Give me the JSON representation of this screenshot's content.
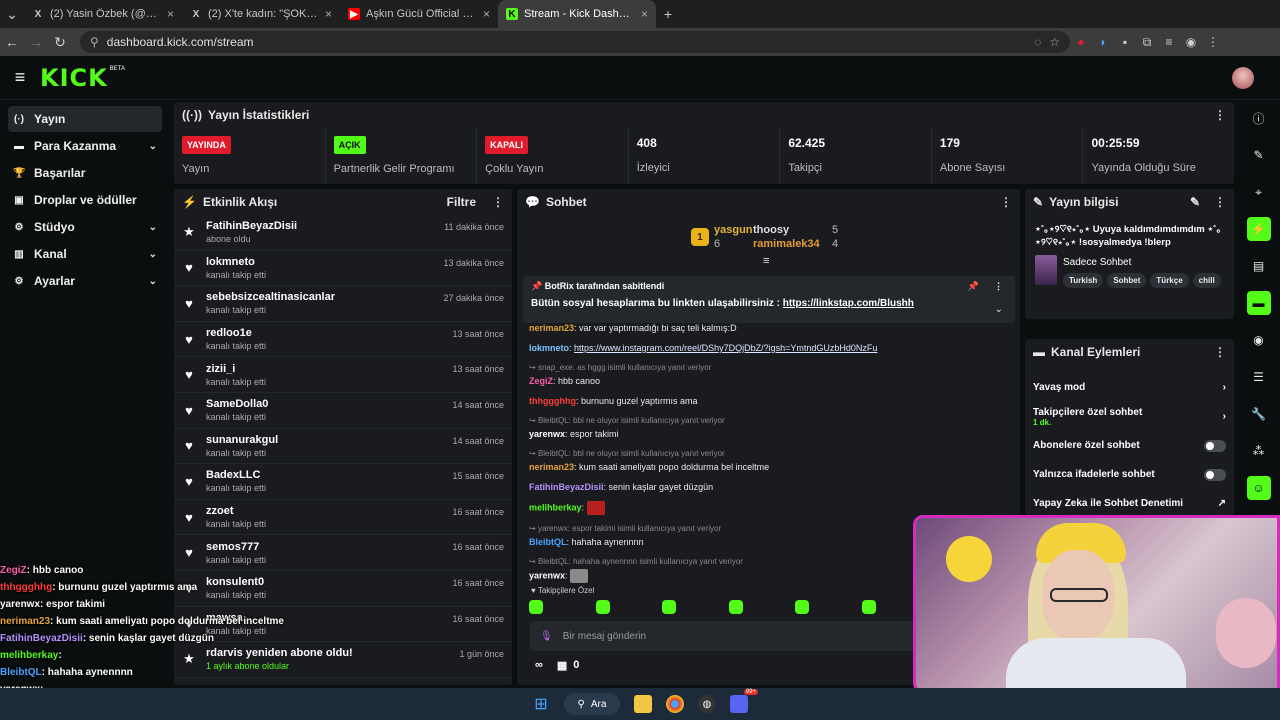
{
  "browser": {
    "tabs": [
      {
        "title": "(2) Yasin Özbek (@yasinozbek_",
        "icon": "X",
        "active": false
      },
      {
        "title": "(2) X'te kadın: \"ŞOK ŞOK ŞOK p",
        "icon": "X",
        "active": false
      },
      {
        "title": "Aşkın Gücü Official - YouTube",
        "icon": "▶",
        "active": false
      },
      {
        "title": "Stream - Kick Dashboard",
        "icon": "K",
        "active": true
      }
    ],
    "url": "dashboard.kick.com/stream"
  },
  "header": {
    "logo": "KICK",
    "beta": "BETA"
  },
  "sidebar": {
    "items": [
      {
        "label": "Yayın",
        "icon": "(·)",
        "chevron": ""
      },
      {
        "label": "Para Kazanma",
        "icon": "▬",
        "chevron": "⌄"
      },
      {
        "label": "Başarılar",
        "icon": "🏆",
        "chevron": ""
      },
      {
        "label": "Droplar ve ödüller",
        "icon": "▣",
        "chevron": ""
      },
      {
        "label": "Stüdyo",
        "icon": "⚙",
        "chevron": "⌄"
      },
      {
        "label": "Kanal",
        "icon": "▥",
        "chevron": "⌄"
      },
      {
        "label": "Ayarlar",
        "icon": "⚙",
        "chevron": "⌄"
      }
    ]
  },
  "stats": {
    "title": "Yayın İstatistikleri",
    "cards": [
      {
        "pill": "YAYINDA",
        "label": "Yayın"
      },
      {
        "pill": "AÇIK",
        "label": "Partnerlik Gelir Programı"
      },
      {
        "pill": "KAPALI",
        "label": "Çoklu Yayın"
      },
      {
        "value": "408",
        "label": "İzleyici"
      },
      {
        "value": "62.425",
        "label": "Takipçi"
      },
      {
        "value": "179",
        "label": "Abone Sayısı"
      },
      {
        "value": "00:25:59",
        "label": "Yayında Olduğu Süre"
      }
    ]
  },
  "feed": {
    "title": "Etkinlik Akışı",
    "filter": "Filtre",
    "items": [
      {
        "name": "FatihinBeyazDisii",
        "sub": "abone oldu",
        "time": "11 dakika önce",
        "icon": "★"
      },
      {
        "name": "lokmneto",
        "sub": "kanalı takip etti",
        "time": "13 dakika önce",
        "icon": "♥"
      },
      {
        "name": "sebebsizcealtinasicanlar",
        "sub": "kanalı takip etti",
        "time": "27 dakika önce",
        "icon": "♥"
      },
      {
        "name": "redloo1e",
        "sub": "kanalı takip etti",
        "time": "13 saat önce",
        "icon": "♥"
      },
      {
        "name": "zizii_i",
        "sub": "kanalı takip etti",
        "time": "13 saat önce",
        "icon": "♥"
      },
      {
        "name": "SameDolla0",
        "sub": "kanalı takip etti",
        "time": "14 saat önce",
        "icon": "♥"
      },
      {
        "name": "sunanurakgul",
        "sub": "kanalı takip etti",
        "time": "14 saat önce",
        "icon": "♥"
      },
      {
        "name": "BadexLLC",
        "sub": "kanalı takip etti",
        "time": "15 saat önce",
        "icon": "♥"
      },
      {
        "name": "zzoet",
        "sub": "kanalı takip etti",
        "time": "16 saat önce",
        "icon": "♥"
      },
      {
        "name": "semos777",
        "sub": "kanalı takip etti",
        "time": "16 saat önce",
        "icon": "♥"
      },
      {
        "name": "konsulent0",
        "sub": "kanalı takip etti",
        "time": "16 saat önce",
        "icon": "♥"
      },
      {
        "name": "mawsa",
        "sub": "kanalı takip etti",
        "time": "16 saat önce",
        "icon": "♥"
      },
      {
        "name": "rdarvis yeniden abone oldu!",
        "sub": "1 aylık abone oldular",
        "time": "1 gün önce",
        "icon": "★"
      }
    ]
  },
  "chat": {
    "title": "Sohbet",
    "leaderboard": {
      "rank": "1",
      "first": {
        "name": "yasgun",
        "count": "6"
      },
      "second": {
        "name": "thoosy",
        "count": "5"
      },
      "third": {
        "name": "ramimalek34",
        "count": "4"
      }
    },
    "pinned": {
      "by": "BotRix tarafından sabitlendi",
      "text": "Bütün sosyal hesaplarıma bu linkten ulaşabilirsiniz : ",
      "link": "https://linkstap.com/Blushh"
    },
    "messages": [
      {
        "reply": "",
        "user": "neriman23",
        "color": "#e5a43b",
        "text": ": var var yaptırmadığı bi saç teli kalmış:D"
      },
      {
        "reply": "",
        "user": "lokmneto",
        "color": "#7cc4ff",
        "text": ": ",
        "link": "https://www.instagram.com/reel/DShy7DQjDbZ/?igsh=YmtndGUzbHd0NzFu"
      },
      {
        "reply": "snap_exe: as hggg isimli kullanıcıya yanıt veriyor",
        "user": "ZegiZ",
        "color": "#ff5fa8",
        "text": ": hbb canoo"
      },
      {
        "reply": "",
        "user": "thhggghhg",
        "color": "#ff3b3b",
        "text": ": burnunu guzel yaptırmıs ama"
      },
      {
        "reply": "BleibtQL: bbl ne oluyor isimli kullanıcıya yanıt veriyor",
        "user": "yarenwx",
        "color": "#ffffff",
        "text": ": espor takimi"
      },
      {
        "reply": "BleibtQL: bbl ne oluyor isimli kullanıcıya yanıt veriyor",
        "user": "neriman23",
        "color": "#e5a43b",
        "text": ": kum saati ameliyatı popo doldurma bel inceltme"
      },
      {
        "reply": "",
        "user": "FatihinBeyazDisii",
        "color": "#b693ff",
        "text": ": senin kaşlar gayet düzgün"
      },
      {
        "reply": "",
        "user": "melihberkay",
        "color": "#53fc18",
        "text": ":"
      },
      {
        "reply": "yarenwx: espor takimi isimli kullanıcıya yanıt veriyor",
        "user": "BleibtQL",
        "color": "#4aa3ff",
        "text": ": hahaha aynennnn"
      },
      {
        "reply": "BleibtQL: hahaha aynennnn isimli kullanıcıya yanıt veriyor",
        "user": "yarenwx",
        "color": "#ffffff",
        "text": ":"
      }
    ],
    "followers_only": "Takipçilere Özel",
    "placeholder": "Bir mesaj gönderin",
    "points": "0"
  },
  "stream_info": {
    "title": "Yayın bilgisi",
    "description": "⋆˚｡⋆୨♡୧⋆˚｡⋆ Uyuya kaldımdımdımdım ⋆˚｡⋆୨♡୧⋆˚｡⋆ !sosyalmedya !blerp",
    "category": "Sadece Sohbet",
    "tags": [
      "Turkish",
      "Sohbet",
      "Türkçe",
      "chill"
    ]
  },
  "channel_actions": {
    "title": "Kanal Eylemleri",
    "rows": [
      {
        "label": "Yavaş mod",
        "sub": "",
        "control": "arrow"
      },
      {
        "label": "Takipçilere özel sohbet",
        "sub": "1 dk.",
        "control": "arrow"
      },
      {
        "label": "Abonelere özel sohbet",
        "sub": "",
        "control": "toggle"
      },
      {
        "label": "Yalnızca ifadelerle sohbet",
        "sub": "",
        "control": "toggle"
      },
      {
        "label": "Yapay Zeka ile Sohbet Denetimi",
        "sub": "",
        "control": "ext"
      }
    ]
  },
  "overlay_chat": [
    {
      "user": "ZegiZ",
      "color": "#ff5fa8",
      "text": ": hbb canoo"
    },
    {
      "user": "thhggghhg",
      "color": "#ff3b3b",
      "text": ": burnunu guzel yaptırmıs ama"
    },
    {
      "user": "yarenwx",
      "color": "#ffffff",
      "text": ": espor takimi"
    },
    {
      "user": "neriman23",
      "color": "#e5a43b",
      "text": ": kum saati ameliyatı popo doldurma bel inceltme"
    },
    {
      "user": "FatihinBeyazDisii",
      "color": "#b693ff",
      "text": ": senin kaşlar gayet düzgün"
    },
    {
      "user": "melihberkay",
      "color": "#53fc18",
      "text": ":"
    },
    {
      "user": "BleibtQL",
      "color": "#4aa3ff",
      "text": ": hahaha aynennnn"
    },
    {
      "user": "yarenwx",
      "color": "#ffffff",
      "text": ":"
    }
  ],
  "taskbar": {
    "search": "Ara",
    "badge": "99+"
  },
  "colors": {
    "accent": "#53fc18",
    "live": "#e01c2c",
    "panel": "#191b1f",
    "bg": "#0b0e0f"
  }
}
